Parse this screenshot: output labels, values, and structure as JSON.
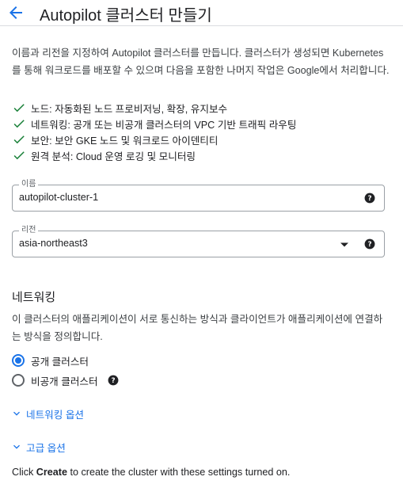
{
  "header": {
    "title": "Autopilot 클러스터 만들기",
    "back_icon": "arrow-back-icon"
  },
  "intro": "이름과 리전을 지정하여 Autopilot 클러스터를 만듭니다. 클러스터가 생성되면 Kubernetes를 통해 워크로드를 배포할 수 있으며 다음을 포함한 나머지 작업은 Google에서 처리합니다.",
  "features": [
    {
      "icon": "check-icon",
      "text": "노드: 자동화된 노드 프로비저닝, 확장, 유지보수"
    },
    {
      "icon": "check-icon",
      "text": "네트워킹: 공개 또는 비공개 클러스터의 VPC 기반 트래픽 라우팅"
    },
    {
      "icon": "check-icon",
      "text": "보안: 보안 GKE 노드 및 워크로드 아이덴티티"
    },
    {
      "icon": "check-icon",
      "text": "원격 분석: Cloud 운영 로깅 및 모니터링"
    }
  ],
  "name_field": {
    "label": "이름",
    "value": "autopilot-cluster-1"
  },
  "region_field": {
    "label": "리전",
    "value": "asia-northeast3"
  },
  "networking": {
    "title": "네트워킹",
    "description": "이 클러스터의 애플리케이션이 서로 통신하는 방식과 클라이언트가 애플리케이션에 연결하는 방식을 정의합니다.",
    "options": [
      {
        "label": "공개 클러스터",
        "selected": true
      },
      {
        "label": "비공개 클러스터",
        "selected": false
      }
    ],
    "options_link": "네트워킹 옵션"
  },
  "advanced_link": "고급 옵션",
  "footer": {
    "prefix": "Click ",
    "bold": "Create",
    "suffix": " to create the cluster with these settings turned on."
  },
  "colors": {
    "accent": "#1a73e8",
    "check": "#188038",
    "text": "#202124"
  }
}
